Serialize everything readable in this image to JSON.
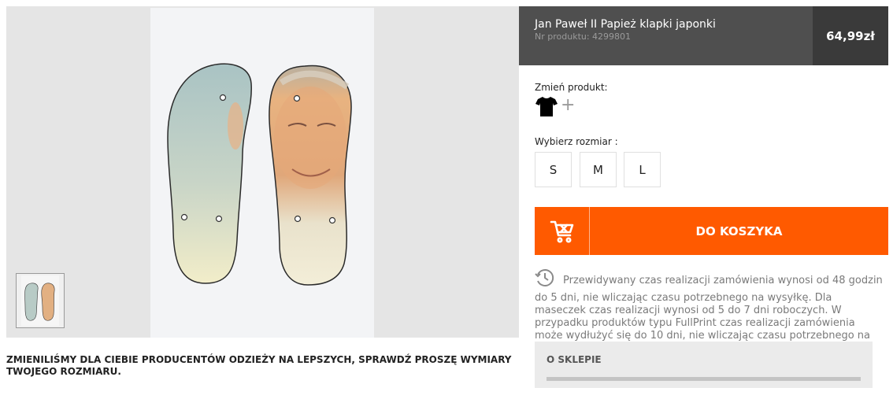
{
  "product": {
    "title": "Jan Paweł II Papież klapki japonki",
    "code": "Nr produktu: 4299801",
    "price": "64,99zł"
  },
  "change_product": {
    "label": "Zmień produkt:",
    "shirt_icon": "tshirt-icon",
    "add_symbol": "+"
  },
  "size": {
    "label": "Wybierz rozmiar :",
    "options": [
      "S",
      "M",
      "L"
    ]
  },
  "cart": {
    "icon": "cart-icon",
    "label": "DO KOSZYKA"
  },
  "delivery": {
    "icon": "clock-icon",
    "text": "Przewidywany czas realizacji zamówienia wynosi od 48 godzin do 5 dni, nie wliczając czasu potrzebnego na wysyłkę. Dla maseczek czas realizacji wynosi od 5 do 7 dni roboczych. W przypadku produktów typu FullPrint czas realizacji zamówienia może wydłużyć się do 10 dni, nie wliczając czasu potrzebnego na wysyłkę. Zamówienia są realizowane tylko w dni robocze."
  },
  "about": {
    "title": "O SKLEPIE"
  },
  "notice": "ZMIENILIŚMY DLA CIEBIE PRODUCENTÓW ODZIEŻY NA LEPSZYCH, SPRAWDŹ PROSZĘ WYMIARY TWOJEGO ROZMIARU.",
  "colors": {
    "accent": "#ff5a00",
    "header_bg": "#4f4f4f",
    "price_bg": "#3a3a3a"
  }
}
